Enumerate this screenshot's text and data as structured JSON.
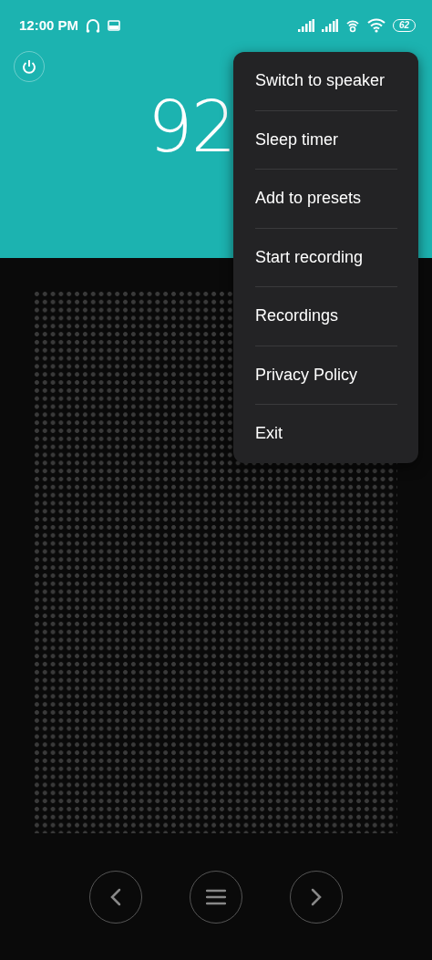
{
  "status_bar": {
    "time": "12:00 PM",
    "battery": "62"
  },
  "frequency": "92",
  "menu": [
    {
      "label": "Switch to speaker"
    },
    {
      "label": "Sleep timer"
    },
    {
      "label": "Add to presets"
    },
    {
      "label": "Start recording"
    },
    {
      "label": "Recordings"
    },
    {
      "label": "Privacy Policy"
    },
    {
      "label": "Exit"
    }
  ]
}
